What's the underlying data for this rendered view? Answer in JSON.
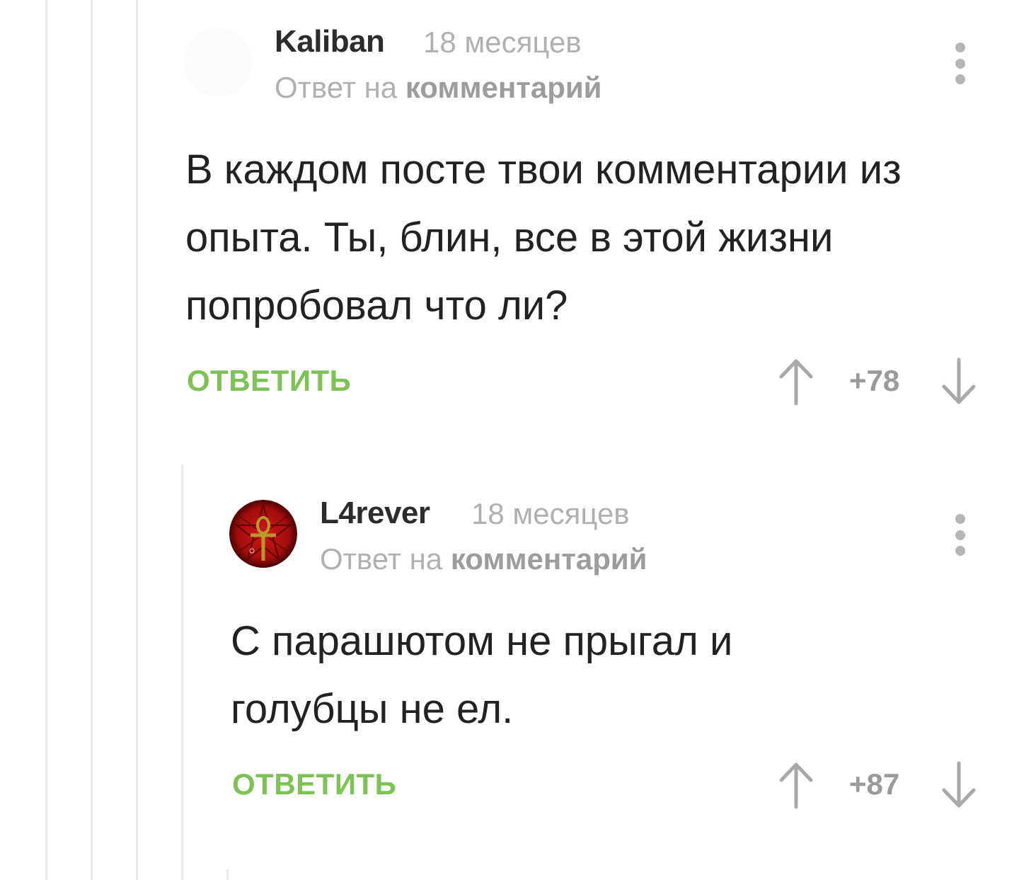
{
  "comments": [
    {
      "author": "Kaliban",
      "time": "18 месяцев",
      "reply_prefix": "Ответ на",
      "reply_link": "комментарий",
      "text": "В каждом посте твои комментарии из опыта. Ты, блин, все в этой жизни попробовал что ли?",
      "reply_label": "ОТВЕТИТЬ",
      "score": "+78"
    },
    {
      "author": "L4rever",
      "time": "18 месяцев",
      "reply_prefix": "Ответ на",
      "reply_link": "комментарий",
      "text": "С парашютом не прыгал и голубцы не ел.",
      "reply_label": "ОТВЕТИТЬ",
      "score": "+87"
    }
  ],
  "colors": {
    "accent_green": "#7cc254",
    "muted_gray": "#b0b0b0",
    "thread_line": "#e9e9e9",
    "avatar_red": "#b51010",
    "ankh_gold": "#b89a2a"
  },
  "icons": [
    "more-vertical-icon",
    "arrow-up-icon",
    "arrow-down-icon",
    "ankh-avatar-icon"
  ]
}
